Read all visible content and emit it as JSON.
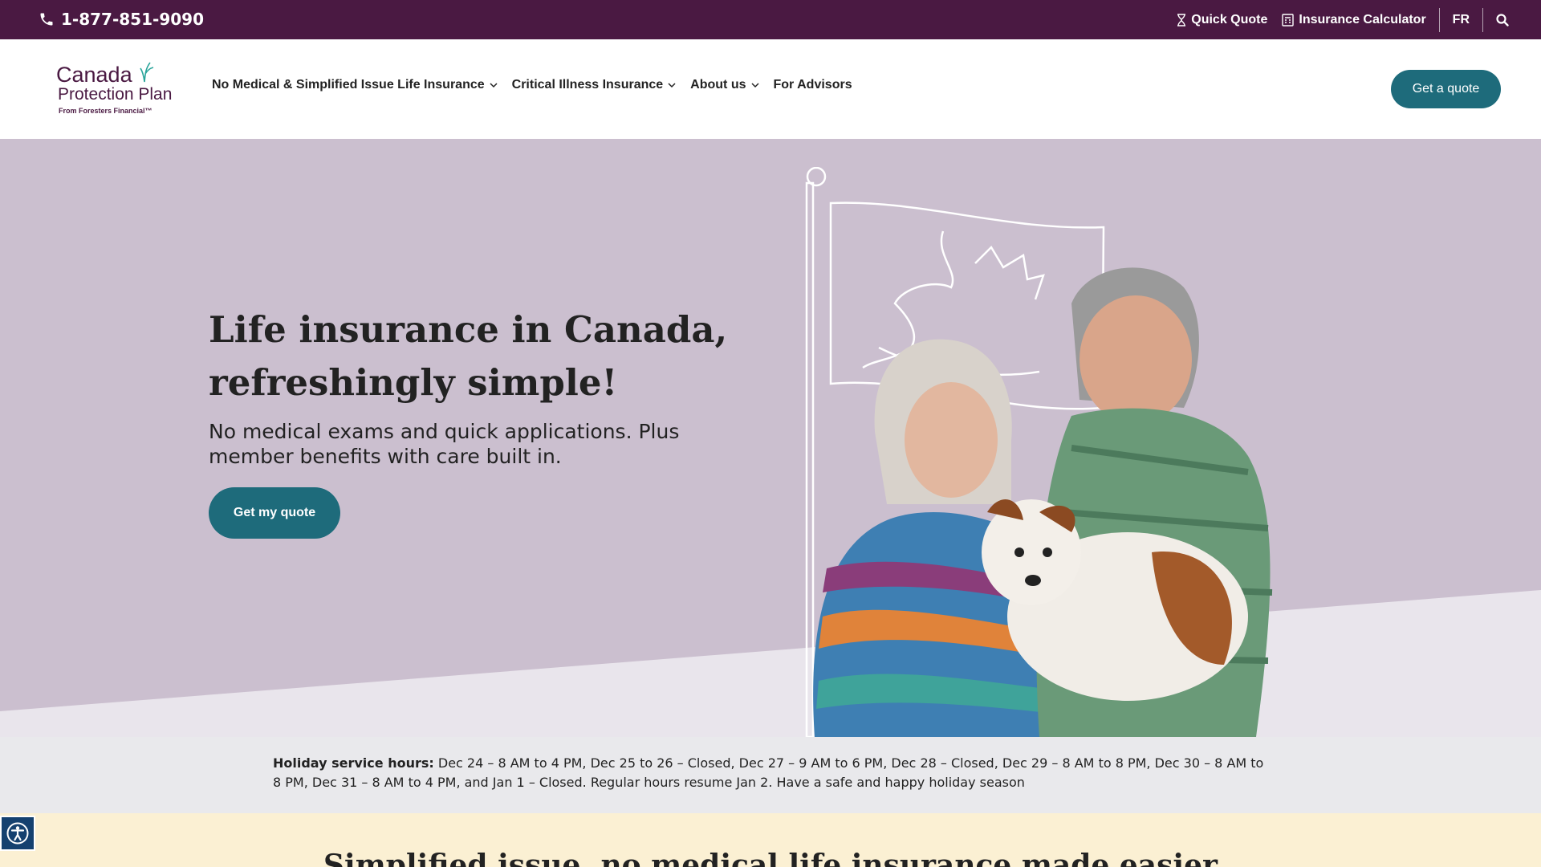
{
  "topbar": {
    "phone": "1-877-851-9090",
    "quick_quote": "Quick Quote",
    "insurance_calculator": "Insurance Calculator",
    "language": "FR"
  },
  "logo": {
    "line1": "Canada",
    "line2": "Protection Plan",
    "line3": "From Foresters Financial™"
  },
  "nav": {
    "items": [
      {
        "label": "No Medical & Simplified Issue Life Insurance"
      },
      {
        "label": "Critical Illness Insurance"
      },
      {
        "label": "About us"
      },
      {
        "label": "For Advisors"
      }
    ],
    "cta": "Get a quote"
  },
  "hero": {
    "title": "Life insurance in Canada, refreshingly simple!",
    "subtitle": "No medical exams and quick applications. Plus member benefits with care built in.",
    "cta": "Get my quote"
  },
  "notice": {
    "label": "Holiday service hours:",
    "text": " Dec 24 – 8 AM to 4 PM, Dec 25 to 26 – Closed, Dec 27 – 9 AM to 6 PM, Dec 28 – Closed, Dec 29 – 8 AM to 8 PM, Dec 30 – 8 AM to 8 PM, Dec 31 – 8 AM to 4 PM, and Jan 1 – Closed. Regular hours resume Jan 2. Have a safe and happy holiday season"
  },
  "section": {
    "heading": "Simplified issue, no medical life insurance made easier"
  },
  "colors": {
    "brand_purple": "#4a1942",
    "teal_button": "#1e6b7b",
    "hero_purple": "#cbbfcf",
    "hero_light": "#e9e5ec",
    "notice_bg": "#e9e9ec",
    "cream": "#fbf0d3"
  }
}
